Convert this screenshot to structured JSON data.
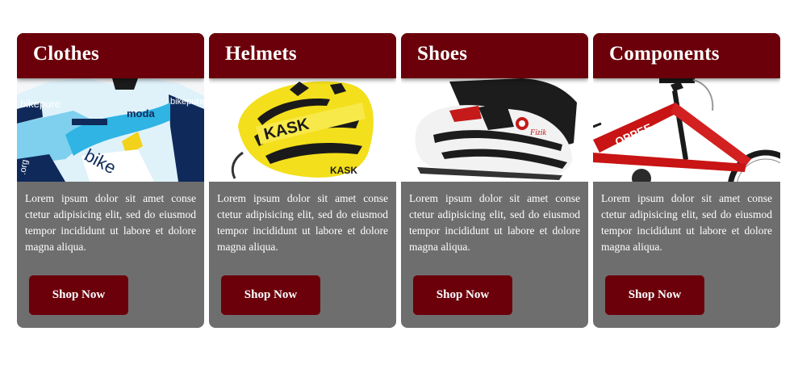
{
  "cards": [
    {
      "title": "Clothes",
      "image_icon": "cycling-jersey-image",
      "description": "Lorem ipsum dolor sit amet conse ctetur adipisicing elit, sed do eiusmod tempor incididunt ut labore et dolore magna aliqua.",
      "button_label": "Shop Now"
    },
    {
      "title": "Helmets",
      "image_icon": "bike-helmet-image",
      "description": "Lorem ipsum dolor sit amet conse ctetur adipisicing elit, sed do eiusmod tempor incididunt ut labore et dolore magna aliqua.",
      "button_label": "Shop Now"
    },
    {
      "title": "Shoes",
      "image_icon": "cycling-shoe-image",
      "description": "Lorem ipsum dolor sit amet conse ctetur adipisicing elit, sed do eiusmod tempor incididunt ut labore et dolore magna aliqua.",
      "button_label": "Shop Now"
    },
    {
      "title": "Components",
      "image_icon": "mountain-bike-image",
      "description": "Lorem ipsum dolor sit amet conse ctetur adipisicing elit, sed do eiusmod tempor incididunt ut labore et dolore magna aliqua.",
      "button_label": "Shop Now"
    }
  ],
  "image_text": {
    "jersey_brand": "bikepure",
    "jersey_sponsor": "moda",
    "helmet_brand": "KASK",
    "shoe_brand": "Fizik",
    "bike_brand": "OPPEE"
  },
  "colors": {
    "header_bg": "#6b000b",
    "card_body_bg": "#6e6e6e",
    "text": "#ffffff"
  }
}
